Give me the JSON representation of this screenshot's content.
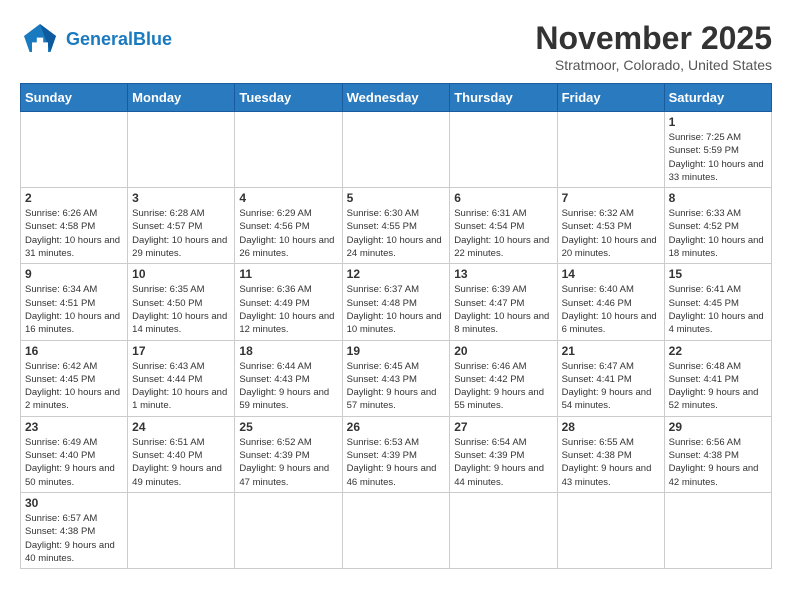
{
  "header": {
    "logo_general": "General",
    "logo_blue": "Blue",
    "month": "November 2025",
    "location": "Stratmoor, Colorado, United States"
  },
  "weekdays": [
    "Sunday",
    "Monday",
    "Tuesday",
    "Wednesday",
    "Thursday",
    "Friday",
    "Saturday"
  ],
  "weeks": [
    [
      {
        "day": "",
        "info": ""
      },
      {
        "day": "",
        "info": ""
      },
      {
        "day": "",
        "info": ""
      },
      {
        "day": "",
        "info": ""
      },
      {
        "day": "",
        "info": ""
      },
      {
        "day": "",
        "info": ""
      },
      {
        "day": "1",
        "info": "Sunrise: 7:25 AM\nSunset: 5:59 PM\nDaylight: 10 hours and 33 minutes."
      }
    ],
    [
      {
        "day": "2",
        "info": "Sunrise: 6:26 AM\nSunset: 4:58 PM\nDaylight: 10 hours and 31 minutes."
      },
      {
        "day": "3",
        "info": "Sunrise: 6:28 AM\nSunset: 4:57 PM\nDaylight: 10 hours and 29 minutes."
      },
      {
        "day": "4",
        "info": "Sunrise: 6:29 AM\nSunset: 4:56 PM\nDaylight: 10 hours and 26 minutes."
      },
      {
        "day": "5",
        "info": "Sunrise: 6:30 AM\nSunset: 4:55 PM\nDaylight: 10 hours and 24 minutes."
      },
      {
        "day": "6",
        "info": "Sunrise: 6:31 AM\nSunset: 4:54 PM\nDaylight: 10 hours and 22 minutes."
      },
      {
        "day": "7",
        "info": "Sunrise: 6:32 AM\nSunset: 4:53 PM\nDaylight: 10 hours and 20 minutes."
      },
      {
        "day": "8",
        "info": "Sunrise: 6:33 AM\nSunset: 4:52 PM\nDaylight: 10 hours and 18 minutes."
      }
    ],
    [
      {
        "day": "9",
        "info": "Sunrise: 6:34 AM\nSunset: 4:51 PM\nDaylight: 10 hours and 16 minutes."
      },
      {
        "day": "10",
        "info": "Sunrise: 6:35 AM\nSunset: 4:50 PM\nDaylight: 10 hours and 14 minutes."
      },
      {
        "day": "11",
        "info": "Sunrise: 6:36 AM\nSunset: 4:49 PM\nDaylight: 10 hours and 12 minutes."
      },
      {
        "day": "12",
        "info": "Sunrise: 6:37 AM\nSunset: 4:48 PM\nDaylight: 10 hours and 10 minutes."
      },
      {
        "day": "13",
        "info": "Sunrise: 6:39 AM\nSunset: 4:47 PM\nDaylight: 10 hours and 8 minutes."
      },
      {
        "day": "14",
        "info": "Sunrise: 6:40 AM\nSunset: 4:46 PM\nDaylight: 10 hours and 6 minutes."
      },
      {
        "day": "15",
        "info": "Sunrise: 6:41 AM\nSunset: 4:45 PM\nDaylight: 10 hours and 4 minutes."
      }
    ],
    [
      {
        "day": "16",
        "info": "Sunrise: 6:42 AM\nSunset: 4:45 PM\nDaylight: 10 hours and 2 minutes."
      },
      {
        "day": "17",
        "info": "Sunrise: 6:43 AM\nSunset: 4:44 PM\nDaylight: 10 hours and 1 minute."
      },
      {
        "day": "18",
        "info": "Sunrise: 6:44 AM\nSunset: 4:43 PM\nDaylight: 9 hours and 59 minutes."
      },
      {
        "day": "19",
        "info": "Sunrise: 6:45 AM\nSunset: 4:43 PM\nDaylight: 9 hours and 57 minutes."
      },
      {
        "day": "20",
        "info": "Sunrise: 6:46 AM\nSunset: 4:42 PM\nDaylight: 9 hours and 55 minutes."
      },
      {
        "day": "21",
        "info": "Sunrise: 6:47 AM\nSunset: 4:41 PM\nDaylight: 9 hours and 54 minutes."
      },
      {
        "day": "22",
        "info": "Sunrise: 6:48 AM\nSunset: 4:41 PM\nDaylight: 9 hours and 52 minutes."
      }
    ],
    [
      {
        "day": "23",
        "info": "Sunrise: 6:49 AM\nSunset: 4:40 PM\nDaylight: 9 hours and 50 minutes."
      },
      {
        "day": "24",
        "info": "Sunrise: 6:51 AM\nSunset: 4:40 PM\nDaylight: 9 hours and 49 minutes."
      },
      {
        "day": "25",
        "info": "Sunrise: 6:52 AM\nSunset: 4:39 PM\nDaylight: 9 hours and 47 minutes."
      },
      {
        "day": "26",
        "info": "Sunrise: 6:53 AM\nSunset: 4:39 PM\nDaylight: 9 hours and 46 minutes."
      },
      {
        "day": "27",
        "info": "Sunrise: 6:54 AM\nSunset: 4:39 PM\nDaylight: 9 hours and 44 minutes."
      },
      {
        "day": "28",
        "info": "Sunrise: 6:55 AM\nSunset: 4:38 PM\nDaylight: 9 hours and 43 minutes."
      },
      {
        "day": "29",
        "info": "Sunrise: 6:56 AM\nSunset: 4:38 PM\nDaylight: 9 hours and 42 minutes."
      }
    ],
    [
      {
        "day": "30",
        "info": "Sunrise: 6:57 AM\nSunset: 4:38 PM\nDaylight: 9 hours and 40 minutes."
      },
      {
        "day": "",
        "info": ""
      },
      {
        "day": "",
        "info": ""
      },
      {
        "day": "",
        "info": ""
      },
      {
        "day": "",
        "info": ""
      },
      {
        "day": "",
        "info": ""
      },
      {
        "day": "",
        "info": ""
      }
    ]
  ]
}
